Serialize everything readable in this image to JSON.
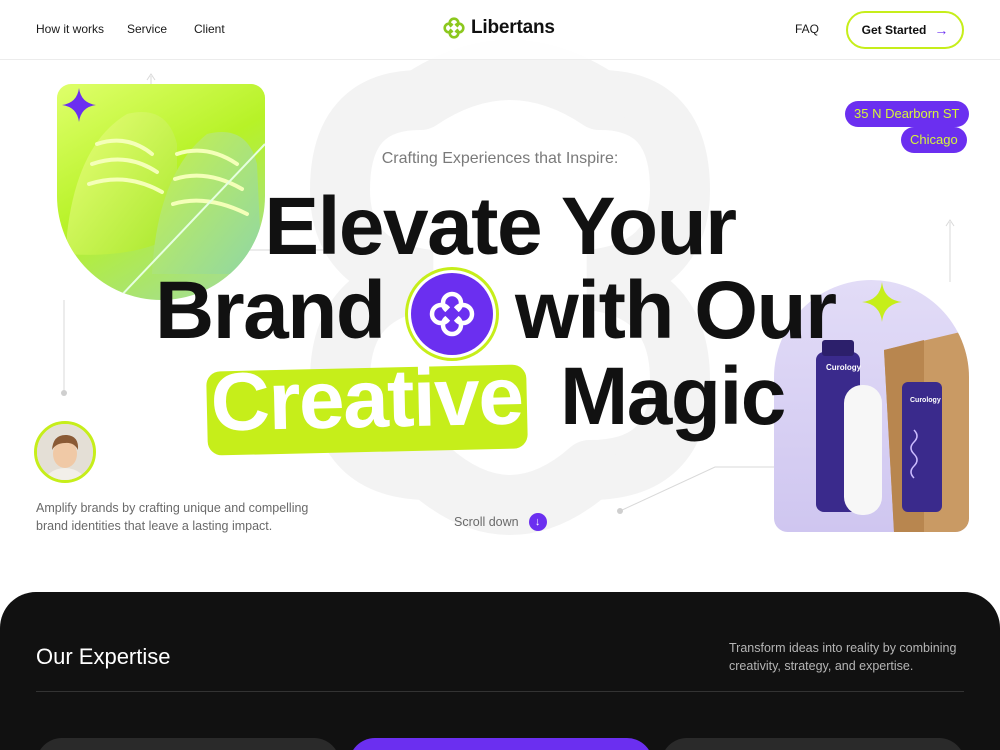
{
  "nav": {
    "links": [
      "How it works",
      "Service",
      "Client"
    ],
    "brand_name": "Libertans",
    "faq_label": "FAQ",
    "cta_label": "Get Started",
    "cta_icon": "arrow-right-icon"
  },
  "hero": {
    "address_line1": "35 N Dearborn ST",
    "address_line2": "Chicago",
    "eyebrow": "Crafting Experiences that Inspire:",
    "headline_line1": "Elevate Your",
    "headline_brand": "Brand",
    "headline_with": "with Our",
    "headline_creative": "Creative",
    "headline_magic": "Magic",
    "tagline": "Amplify brands by crafting unique and compelling brand identities that leave a lasting impact.",
    "scroll_label": "Scroll down",
    "product_brand": "Curology"
  },
  "expertise": {
    "title": "Our Expertise",
    "description": "Transform ideas into reality by combining creativity, strategy, and expertise."
  },
  "colors": {
    "accent_purple": "#6b2ff0",
    "accent_lime": "#c6ee1a",
    "dark_bg": "#111111"
  }
}
